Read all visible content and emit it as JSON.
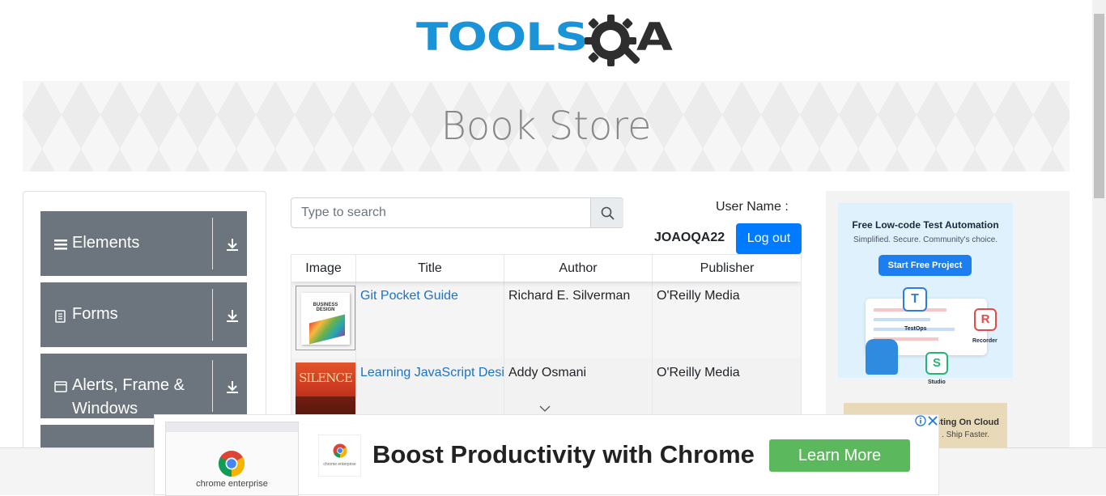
{
  "header": {
    "logo_text": "TOOLS",
    "logo_suffix": "A",
    "logo_name": "TOOLSQA"
  },
  "banner": {
    "title": "Book Store"
  },
  "sidebar": {
    "items": [
      {
        "label": "Elements",
        "icon": "hamburger-icon"
      },
      {
        "label": "Forms",
        "icon": "document-icon"
      },
      {
        "label": "Alerts, Frame &",
        "label2": "Windows",
        "icon": "window-icon"
      }
    ]
  },
  "search": {
    "placeholder": "Type to search",
    "value": ""
  },
  "user": {
    "label": "User Name :",
    "value": "JOAOQA22",
    "logout_label": "Log out"
  },
  "table": {
    "columns": [
      "Image",
      "Title",
      "Author",
      "Publisher"
    ],
    "rows": [
      {
        "title": "Git Pocket Guide",
        "author": "Richard E. Silverman",
        "publisher": "O'Reilly Media",
        "cover_text": "BUSINESS DESIGN"
      },
      {
        "title": "Learning JavaScript Design Patterns",
        "author": "Addy Osmani",
        "publisher": "O'Reilly Media",
        "cover_text": "SILENCE"
      }
    ]
  },
  "ad_right": {
    "headline": "Free Low-code Test Automation",
    "subline": "Simplified. Secure. Community's choice.",
    "button": "Start Free Project",
    "labels": [
      "TestOps",
      "Recorder",
      "Studio"
    ],
    "card2_line1": "sting On Cloud",
    "card2_line2": ". Ship Faster."
  },
  "ad_bottom": {
    "headline": "Boost Productivity with Chrome",
    "cta": "Learn More",
    "thumb_caption": "chrome enterprise",
    "thumb2_caption": "chrome enterprise"
  },
  "colors": {
    "brand_blue": "#1b93d8",
    "sidebar_gray": "#6c757d",
    "primary": "#007bff",
    "cta_green": "#5cb85c"
  }
}
